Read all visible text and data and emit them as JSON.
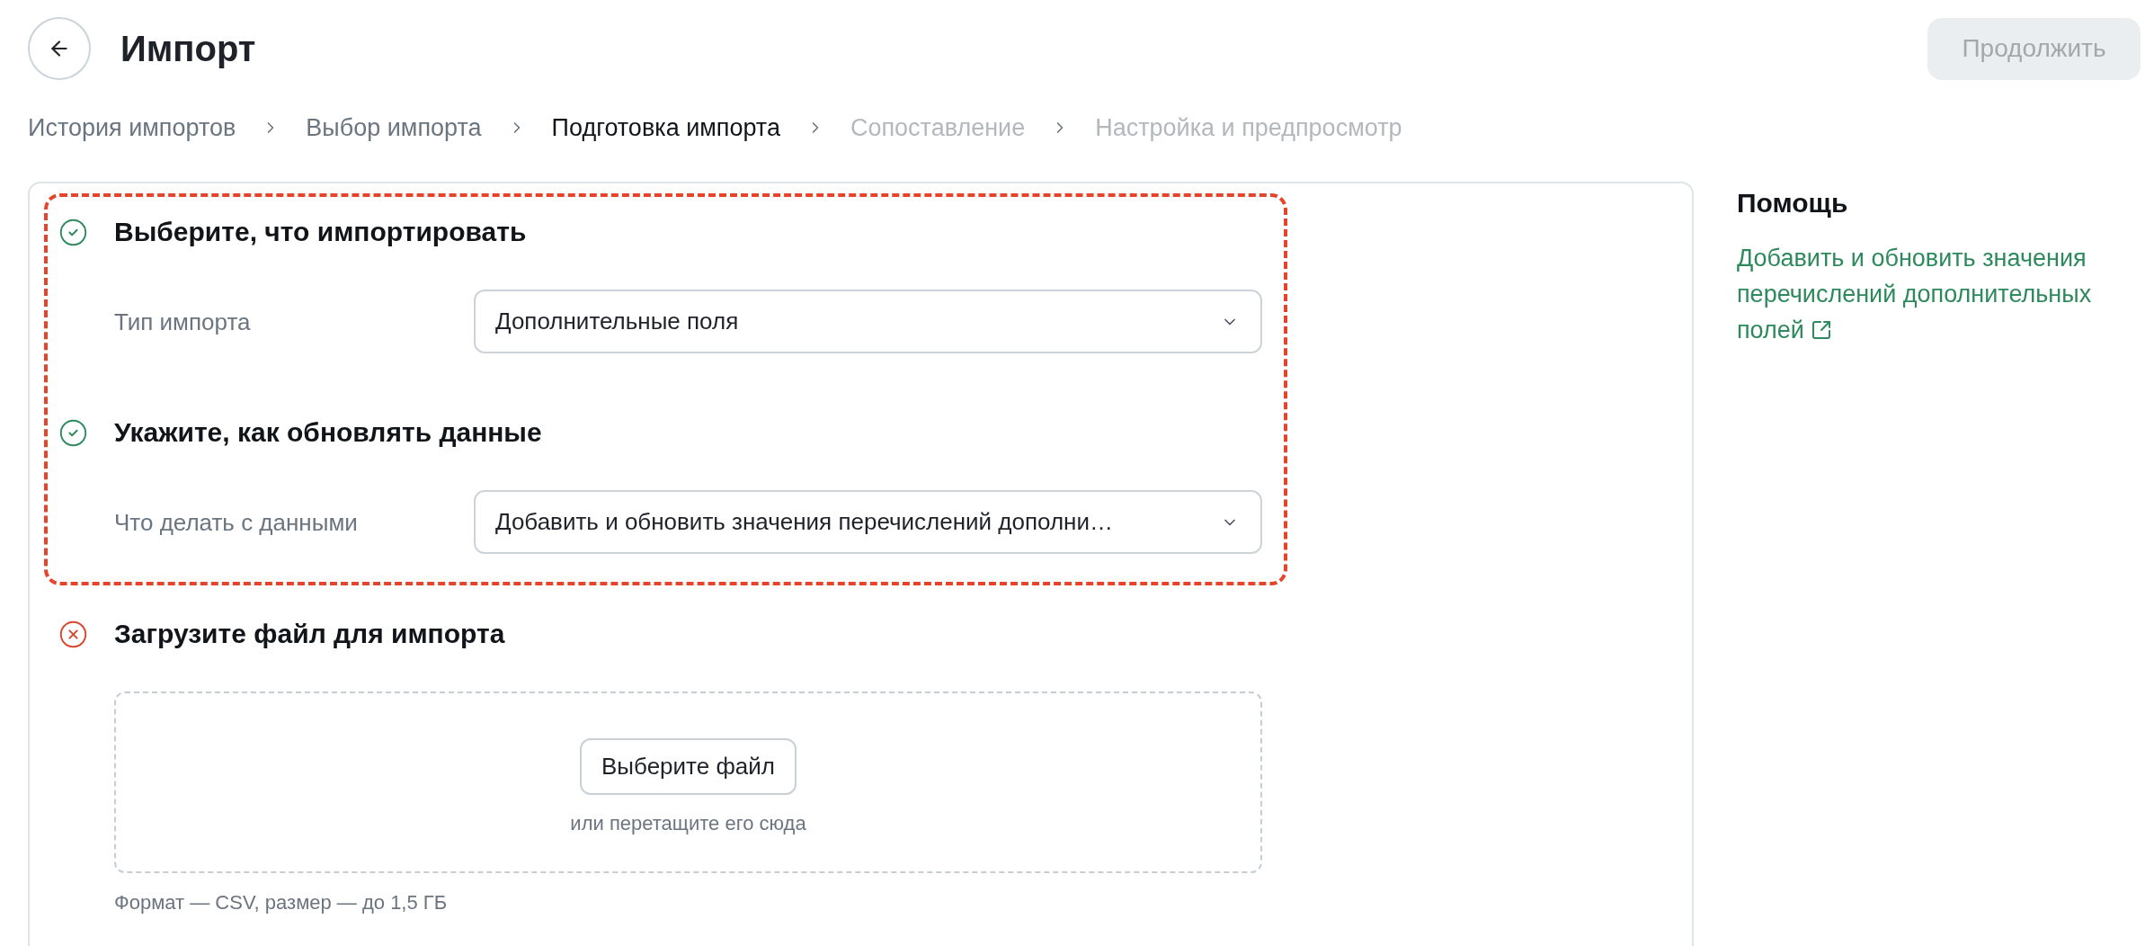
{
  "header": {
    "title": "Импорт",
    "continue_button": {
      "label": "Продолжить",
      "disabled": true
    }
  },
  "breadcrumbs": [
    {
      "label": "История импортов",
      "selected": false,
      "disabled": false
    },
    {
      "label": "Выбор импорта",
      "selected": false,
      "disabled": false
    },
    {
      "label": "Подготовка импорта",
      "selected": true,
      "disabled": false
    },
    {
      "label": "Сопоставление",
      "selected": false,
      "disabled": true
    },
    {
      "label": "Настройка и предпросмотр",
      "selected": false,
      "disabled": true
    }
  ],
  "sections": [
    {
      "kind": "select",
      "title": "Выберите, что импортировать",
      "complete": true,
      "highlighted": true,
      "fields": [
        {
          "label": "Тип импорта",
          "value": "Дополнительные поля"
        }
      ]
    },
    {
      "kind": "select",
      "title": "Укажите, как обновлять данные",
      "complete": true,
      "highlighted": true,
      "fields": [
        {
          "label": "Что делать с данными",
          "value": "Добавить и обновить значения перечислений дополни…"
        }
      ]
    },
    {
      "kind": "upload",
      "title": "Загрузите файл для импорта",
      "complete": false,
      "highlighted": false,
      "upload": {
        "button": "Выберите файл",
        "hint": "или перетащите его сюда",
        "note": "Формат — CSV, размер — до 1,5 ГБ"
      }
    }
  ],
  "help": {
    "title": "Помощь",
    "link": "Добавить и обновить значения перечислений дополнительных полей"
  }
}
